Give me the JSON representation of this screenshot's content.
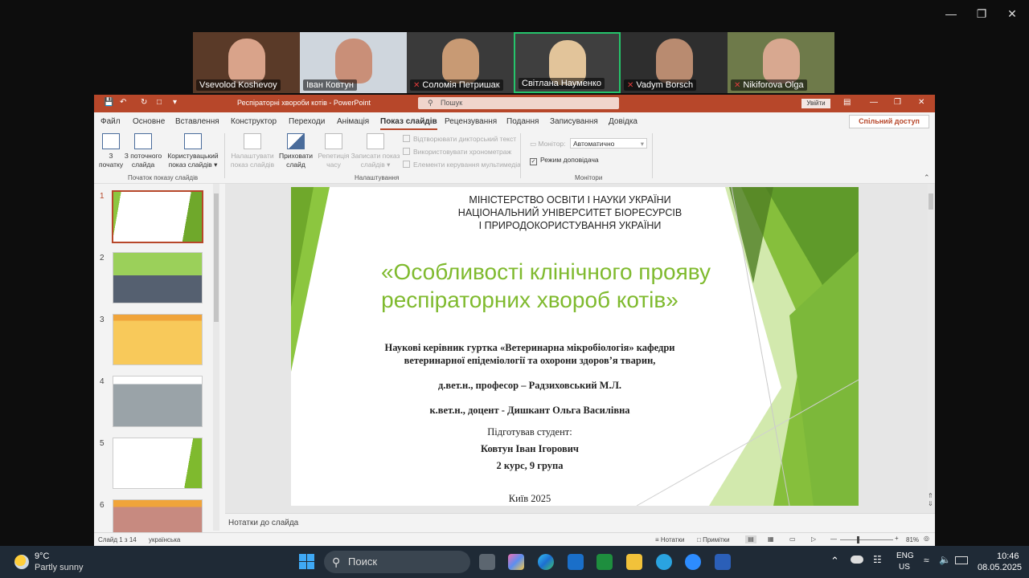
{
  "participants": [
    {
      "name": "Vsevolod Koshevoy",
      "muted": false,
      "active": false,
      "bg": "#5a3a28",
      "face": "#d9a38a"
    },
    {
      "name": "Іван Ковтун",
      "muted": false,
      "active": false,
      "bg": "#cfd6dd",
      "face": "#c98f78"
    },
    {
      "name": "Соломія Петришак",
      "muted": true,
      "active": false,
      "bg": "#3a3a3a",
      "face": "#c89a74"
    },
    {
      "name": "Світлана Науменко",
      "muted": false,
      "active": true,
      "bg": "#3f3f3f",
      "face": "#e2c49a"
    },
    {
      "name": "Vadym Borsch",
      "muted": true,
      "active": false,
      "bg": "#2e2e2e",
      "face": "#b98b70"
    },
    {
      "name": "Nikiforova Olga",
      "muted": true,
      "active": false,
      "bg": "#6e7a4a",
      "face": "#d8a890"
    }
  ],
  "ppt": {
    "title": "Респіраторні хвороби котів  -  PowerPoint",
    "search_placeholder": "Пошук",
    "signin": "Увійти",
    "share": "Спільний доступ",
    "menu": [
      "Файл",
      "Основне",
      "Вставлення",
      "Конструктор",
      "Переходи",
      "Анімація",
      "Показ слайдів",
      "Рецензування",
      "Подання",
      "Записування",
      "Довідка"
    ],
    "active_menu": "Показ слайдів",
    "ribbon": {
      "from_start": "З\nпочатку",
      "from_current": "З поточного\nслайда",
      "custom_show": "Користувацький\nпоказ слайдів ▾",
      "group_start": "Початок показу слайдів",
      "setup_show": "Налаштувати\nпоказ слайдів",
      "hide_slide": "Приховати\nслайд",
      "rehearse": "Репетиція\nчасу",
      "record": "Записати показ\nслайдів ▾",
      "play_narrations": "Відтворювати дикторський текст",
      "use_timings": "Використовувати хронометраж",
      "media_controls": "Елементи керування мультимедіа",
      "group_setup": "Налаштування",
      "monitor_label": "Монітор:",
      "monitor_value": "Автоматично",
      "presenter_view": "Режим доповідача",
      "group_monitors": "Монітори"
    },
    "thumbnail_numbers": [
      "1",
      "2",
      "3",
      "4",
      "5",
      "6"
    ],
    "slide": {
      "ministry_l1": "МІНІСТЕРСТВО ОСВІТИ І НАУКИ УКРАЇНИ",
      "ministry_l2": "НАЦІОНАЛЬНИЙ УНІВЕРСИТЕТ БІОРЕСУРСІВ",
      "ministry_l3": "І ПРИРОДОКОРИСТУВАННЯ УКРАЇНИ",
      "title_l1": "«Особливості клінічного прояву",
      "title_l2": "респіраторних хвороб котів»",
      "advisors_l1": "Наукові керівник гуртка «Ветеринарна мікробіологія» кафедри",
      "advisors_l2": "ветеринарної епідеміології та охорони здоров’я тварин,",
      "prof": "д.вет.н., професор – Радзиховський М.Л.",
      "docent": "к.вет.н., доцент - Дишкант Ольга Василівна",
      "prepared": "Підготував студент:",
      "student": "Ковтун Іван Ігорович",
      "course": "2 курс, 9 група",
      "city": "Київ 2025"
    },
    "notes_placeholder": "Нотатки до слайда",
    "status": {
      "slide_of": "Слайд 1 з 14",
      "language": "українська",
      "notes_btn": "Нотатки",
      "comments_btn": "Примітки",
      "zoom": "81%"
    }
  },
  "taskbar": {
    "weather_temp": "9°C",
    "weather_desc": "Partly sunny",
    "search": "Поиск",
    "lang1": "ENG",
    "lang2": "US",
    "time": "10:46",
    "date": "08.05.2025"
  },
  "colors": {
    "ppt_accent": "#b7472a",
    "slide_green": "#7fba2e",
    "active_tile": "#25c46b"
  }
}
